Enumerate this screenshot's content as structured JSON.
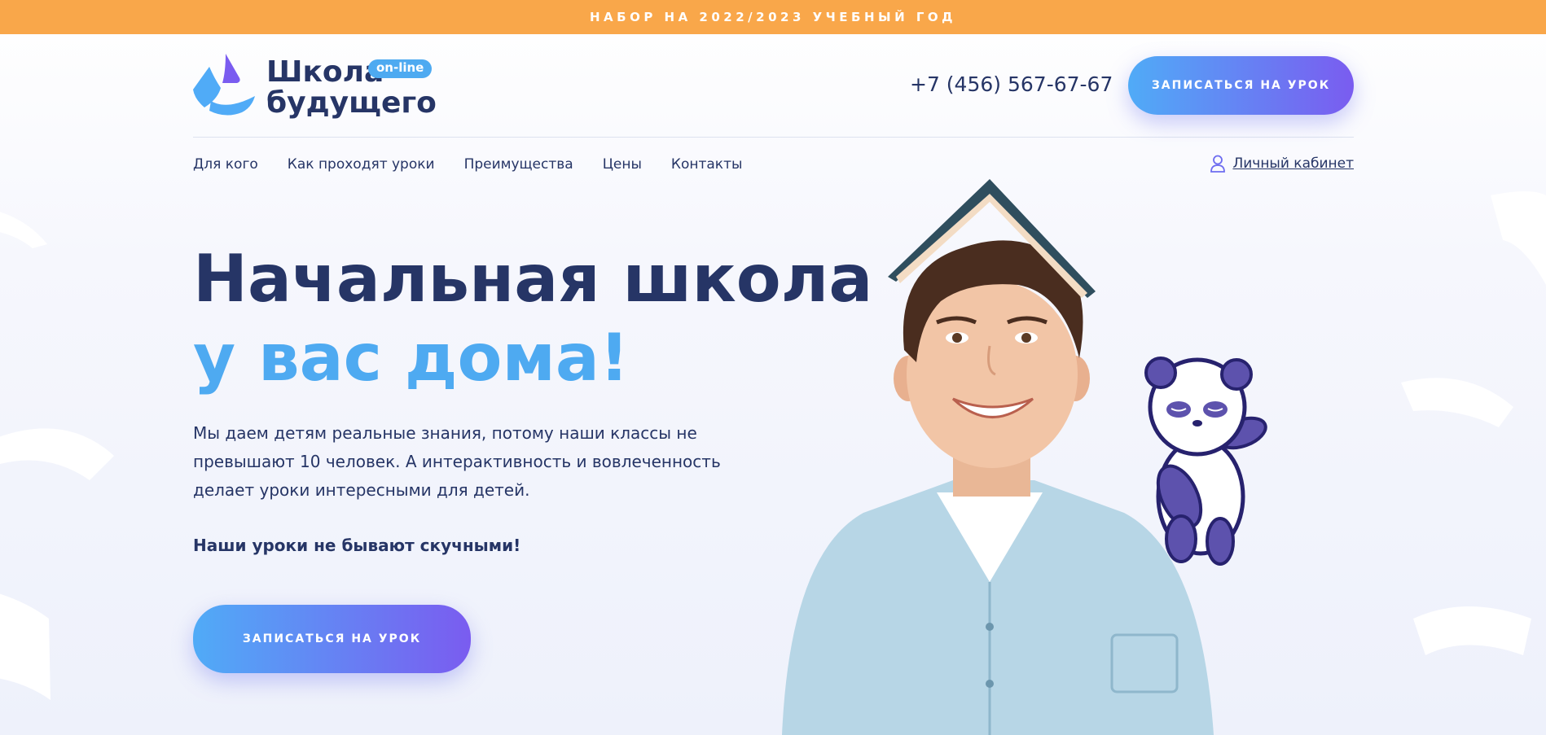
{
  "announcement": {
    "text": "НАБОР НА 2022/2023 УЧЕБНЫЙ ГОД"
  },
  "logo": {
    "line1": "Школа",
    "line2": "будущего",
    "badge": "on-line"
  },
  "header": {
    "phone": "+7 (456) 567-67-67",
    "cta_label": "ЗАПИСАТЬСЯ НА УРОК"
  },
  "nav": {
    "items": [
      {
        "label": "Для кого"
      },
      {
        "label": "Как проходят уроки"
      },
      {
        "label": "Преимущества"
      },
      {
        "label": "Цены"
      },
      {
        "label": "Контакты"
      }
    ],
    "account_label": "Личный кабинет"
  },
  "hero": {
    "title_line1": "Начальная школа",
    "title_line2": "у вас дома!",
    "description": "Мы даем детям реальные знания, потому наши классы не превышают 10 человек. А интерактивность и вовлеченность делает уроки интересными для детей.",
    "accent": "Наши уроки не бывают скучными!",
    "cta_label": "ЗАПИСАТЬСЯ НА УРОК"
  },
  "colors": {
    "announcement_bg": "#f9a74a",
    "primary_text": "#263566",
    "accent_blue": "#4eaaf1",
    "button_gradient_start": "#50abf7",
    "button_gradient_end": "#7a5cf0"
  },
  "icons": {
    "logo_mark": "school-logo-icon",
    "account": "user-icon"
  }
}
